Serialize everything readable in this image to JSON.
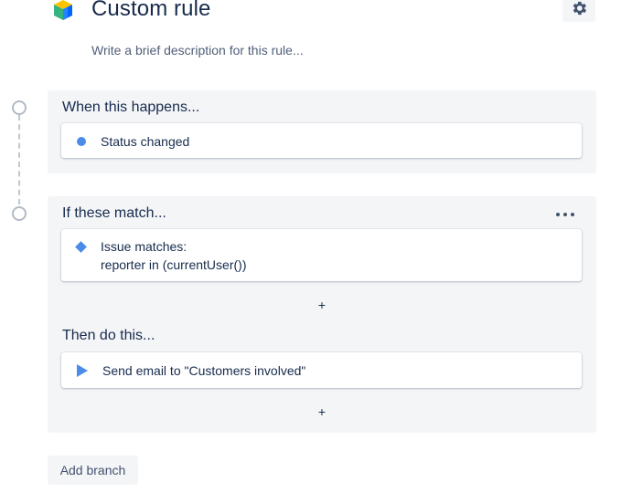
{
  "header": {
    "title": "Custom rule",
    "description_placeholder": "Write a brief description for this rule...",
    "app_icon": "automation-cube-icon",
    "settings_icon": "gear-icon"
  },
  "trigger": {
    "heading": "When this happens...",
    "card": {
      "icon": "dot-icon",
      "text": "Status changed"
    }
  },
  "condition": {
    "heading": "If these match...",
    "menu_icon": "more-icon",
    "card": {
      "icon": "diamond-icon",
      "line1": "Issue matches:",
      "line2": "reporter in (currentUser())"
    },
    "add_label": "+"
  },
  "action": {
    "heading": "Then do this...",
    "card": {
      "icon": "play-icon",
      "text": "Send email to \"Customers involved\""
    },
    "add_label": "+"
  },
  "footer": {
    "add_branch_label": "Add branch"
  },
  "colors": {
    "accent": "#4c8ce8",
    "panel_bg": "#f4f5f7",
    "text": "#172b4d",
    "muted": "#505f79"
  }
}
